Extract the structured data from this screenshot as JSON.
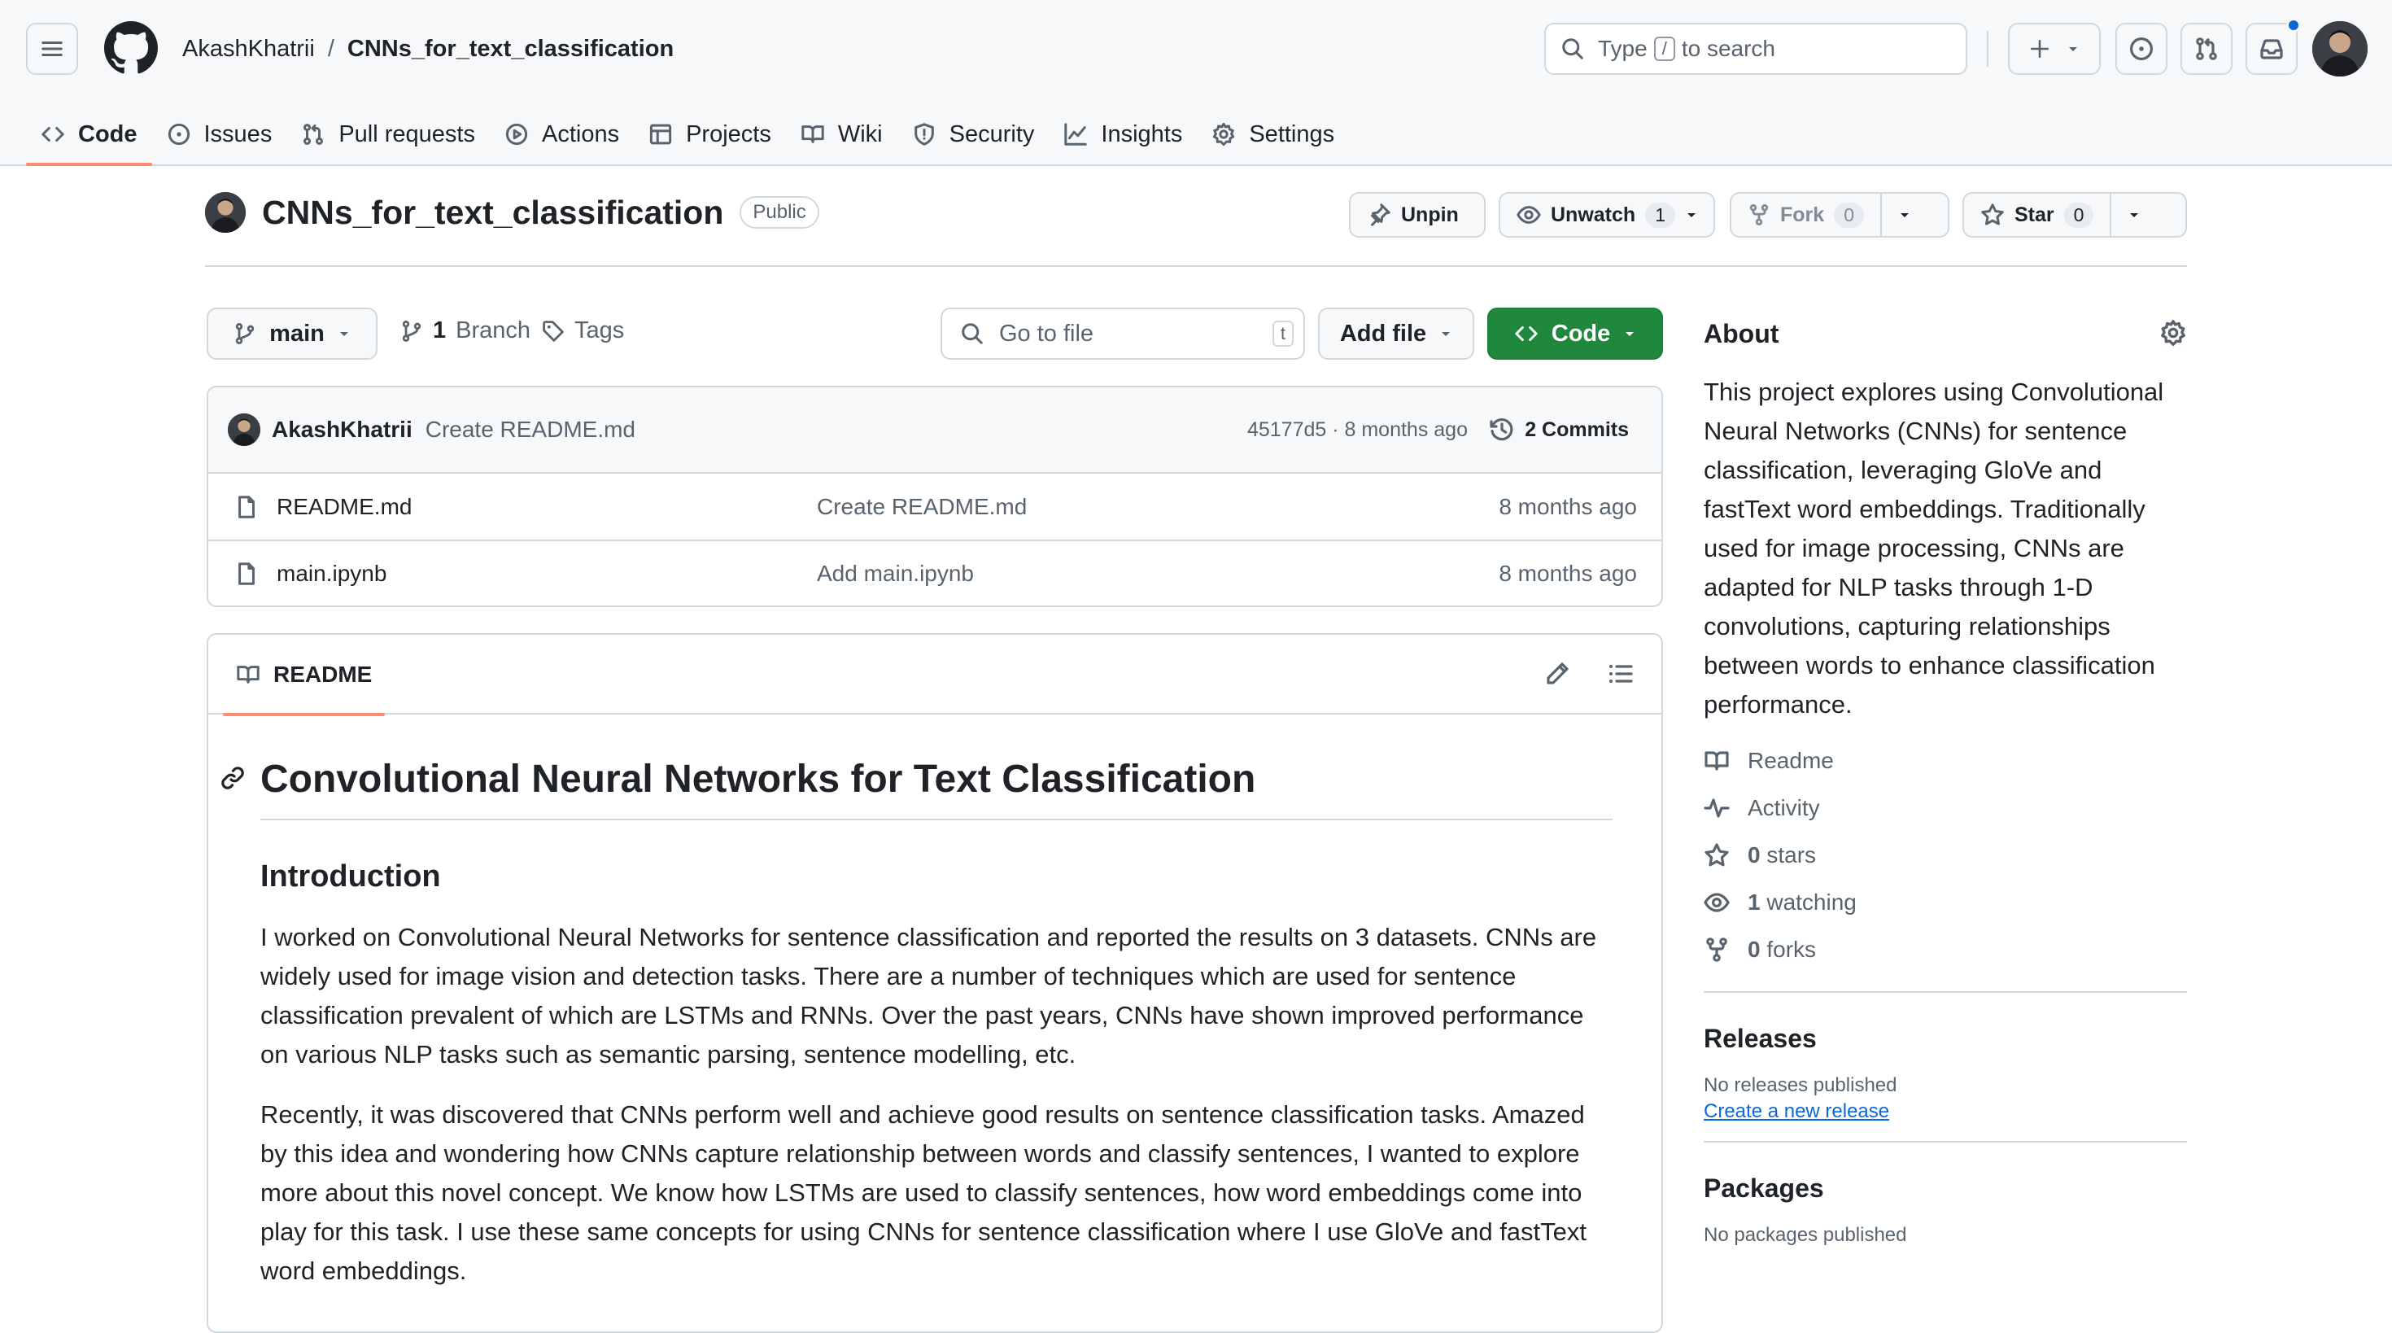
{
  "header": {
    "owner": "AkashKhatrii",
    "separator": "/",
    "repo": "CNNs_for_text_classification",
    "search": {
      "before": "Type",
      "key": "/",
      "after": "to search"
    }
  },
  "tabs": [
    "Code",
    "Issues",
    "Pull requests",
    "Actions",
    "Projects",
    "Wiki",
    "Security",
    "Insights",
    "Settings"
  ],
  "repo": {
    "name": "CNNs_for_text_classification",
    "visibility": "Public",
    "unpin": "Unpin",
    "unwatch": "Unwatch",
    "watch_count": "1",
    "fork": "Fork",
    "fork_count": "0",
    "star": "Star",
    "star_count": "0"
  },
  "filenav": {
    "branch": "main",
    "branch_count": "1",
    "branch_label": "Branch",
    "tags": "Tags",
    "goto_placeholder": "Go to file",
    "goto_key": "t",
    "add_file": "Add file",
    "code": "Code"
  },
  "commit": {
    "author": "AkashKhatrii",
    "message": "Create README.md",
    "meta": "45177d5 · 8 months ago",
    "commits": "2 Commits"
  },
  "files": [
    {
      "name": "README.md",
      "message": "Create README.md",
      "date": "8 months ago"
    },
    {
      "name": "main.ipynb",
      "message": "Add main.ipynb",
      "date": "8 months ago"
    }
  ],
  "readme": {
    "tab": "README",
    "h1": "Convolutional Neural Networks for Text Classification",
    "h2": "Introduction",
    "p1": "I worked on Convolutional Neural Networks for sentence classification and reported the results on 3 datasets. CNNs are widely used for image vision and detection tasks. There are a number of techniques which are used for sentence classification prevalent of which are LSTMs and RNNs. Over the past years, CNNs have shown improved performance on various NLP tasks such as semantic parsing, sentence modelling, etc.",
    "p2": "Recently, it was discovered that CNNs perform well and achieve good results on sentence classification tasks. Amazed by this idea and wondering how CNNs capture relationship between words and classify sentences, I wanted to explore more about this novel concept. We know how LSTMs are used to classify sentences, how word embeddings come into play for this task. I use these same concepts for using CNNs for sentence classification where I use GloVe and fastText word embeddings."
  },
  "about": {
    "title": "About",
    "description": "This project explores using Convolutional Neural Networks (CNNs) for sentence classification, leveraging GloVe and fastText word embeddings. Traditionally used for image processing, CNNs are adapted for NLP tasks through 1-D convolutions, capturing relationships between words to enhance classification performance.",
    "readme": "Readme",
    "activity": "Activity",
    "stars_n": "0",
    "stars": "stars",
    "watching_n": "1",
    "watching": "watching",
    "forks_n": "0",
    "forks": "forks"
  },
  "releases": {
    "title": "Releases",
    "none": "No releases published",
    "create": "Create a new release"
  },
  "packages": {
    "title": "Packages",
    "none": "No packages published"
  },
  "colors": {
    "accent_tab": "#fd8c73",
    "code_button": "#1f883d",
    "link": "#0969da"
  }
}
